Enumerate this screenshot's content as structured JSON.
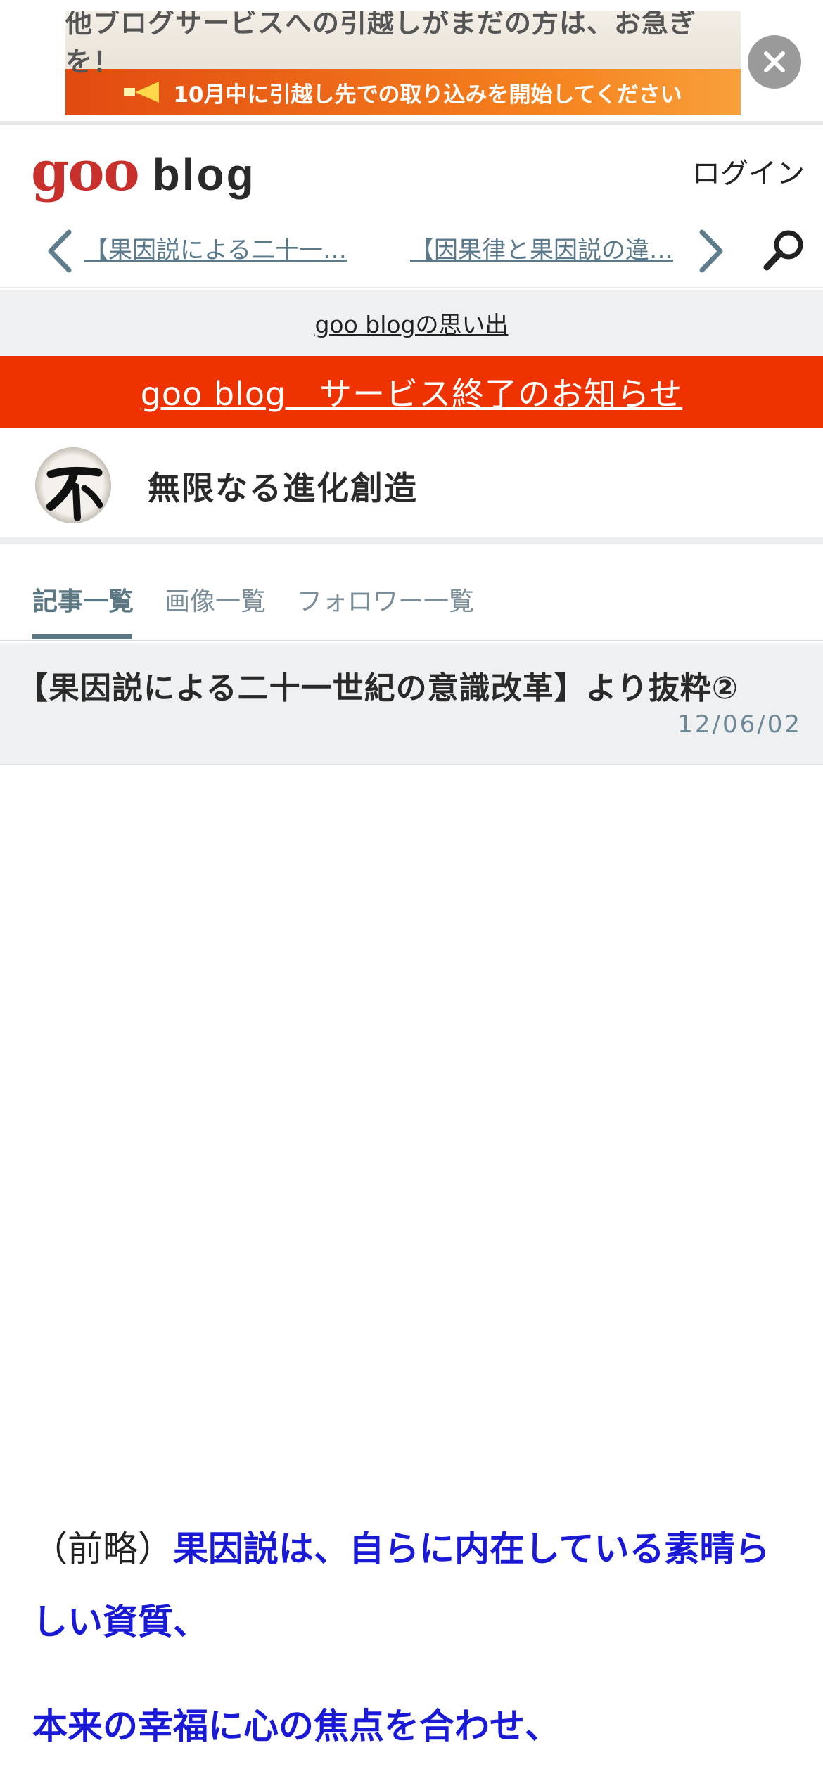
{
  "ad": {
    "line1": "他ブログサービスへの引越しがまだの方は、お急ぎを！",
    "line2": "10月中に引越し先での取り込みを開始してください"
  },
  "header": {
    "logo_goo": "goo",
    "logo_blog": "blog",
    "login": "ログイン",
    "prev_article": "【果因説による二十一…",
    "next_article": "【因果律と果因説の違…"
  },
  "memories_link": "goo blogの思い出",
  "notice": "goo blog　サービス終了のお知らせ",
  "blog": {
    "title": "無限なる進化創造"
  },
  "tabs": [
    {
      "label": "記事一覧"
    },
    {
      "label": "画像一覧"
    },
    {
      "label": "フォロワー一覧"
    }
  ],
  "article": {
    "title": "【果因説による二十一世紀の意識改革】より抜粋②",
    "date": "12/06/02",
    "para1_prefix": "（前略）",
    "para1_text": "果因説は、自らに内在している素晴らしい資質、",
    "para2_text": "本来の幸福に心の焦点を合わせ、"
  },
  "colors": {
    "brand_red": "#c8302c",
    "notice_bg": "#ee3300",
    "emphasis_blue": "#1a1ad6",
    "tab_active": "#5b7784"
  }
}
